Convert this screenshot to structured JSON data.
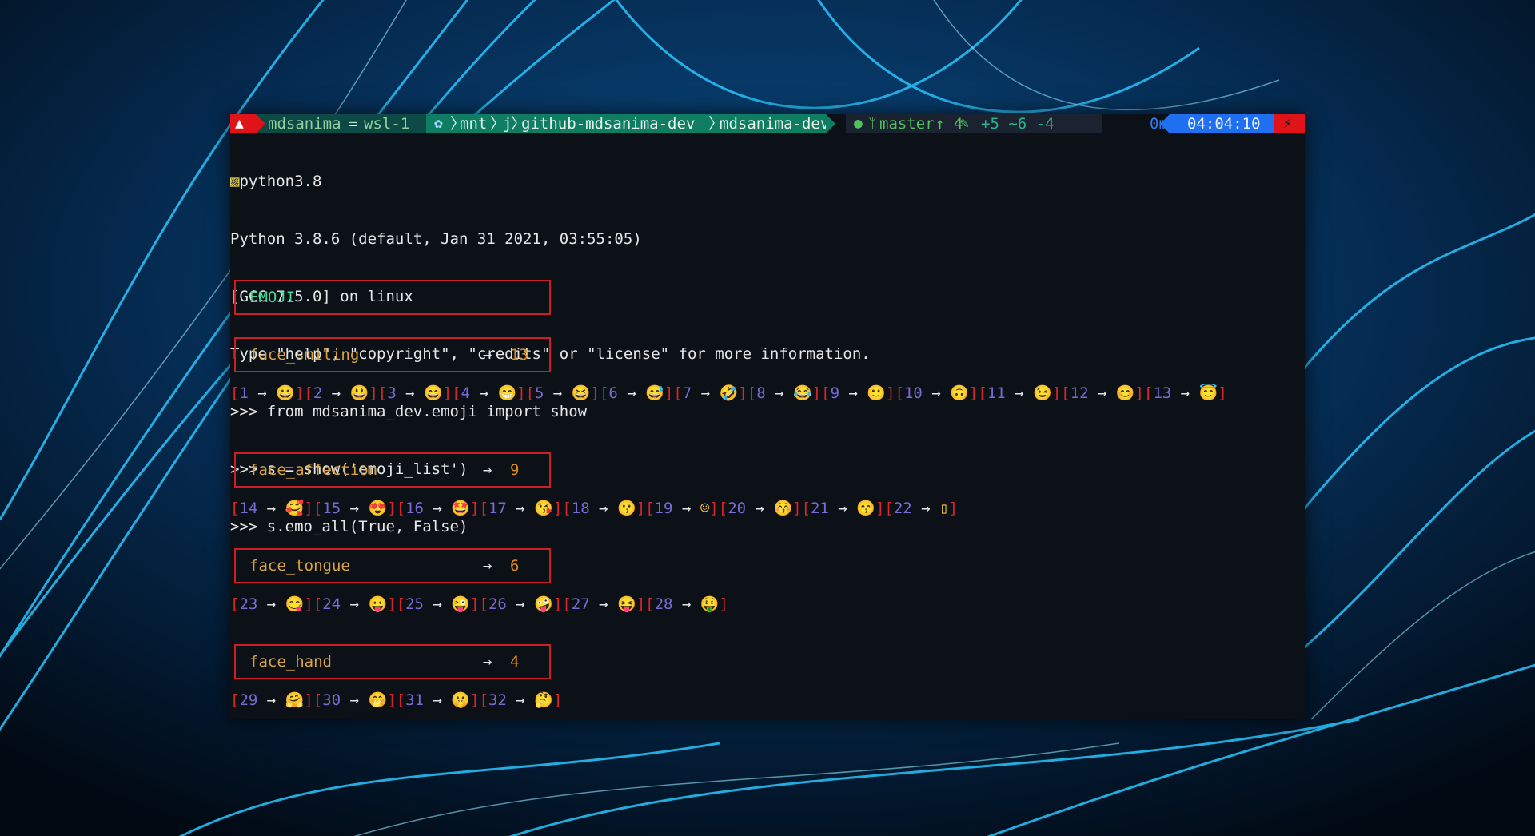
{
  "prompt": {
    "user": "mdsanima",
    "host": "wsl-1",
    "path": [
      "mnt",
      "j",
      "github-mdsanima-dev",
      "mdsanima-dev"
    ],
    "branch": "master",
    "ahead": "↑ 4",
    "changes": "+5 ~6 -4",
    "duration": "0ms",
    "clock": "04:04:10"
  },
  "console": {
    "lines": [
      "python3.8",
      "Python 3.8.6 (default, Jan 31 2021, 03:55:05)",
      "[GCC 7.5.0] on linux",
      "Type \"help\", \"copyright\", \"credits\" or \"license\" for more information.",
      ">>> from mdsanima_dev.emoji import show",
      ">>> s = show('emoji_list')",
      ">>> s.emo_all(True, False)"
    ]
  },
  "title_box": {
    "label": "EMOJI"
  },
  "arrow_glyph": "→",
  "groups": [
    {
      "label": "face_smiling",
      "count": "13",
      "items": [
        {
          "n": "1",
          "e": "😀"
        },
        {
          "n": "2",
          "e": "😃"
        },
        {
          "n": "3",
          "e": "😄"
        },
        {
          "n": "4",
          "e": "😁"
        },
        {
          "n": "5",
          "e": "😆"
        },
        {
          "n": "6",
          "e": "😅"
        },
        {
          "n": "7",
          "e": "🤣"
        },
        {
          "n": "8",
          "e": "😂"
        },
        {
          "n": "9",
          "e": "🙂"
        },
        {
          "n": "10",
          "e": "🙃"
        },
        {
          "n": "11",
          "e": "😉"
        },
        {
          "n": "12",
          "e": "😊"
        },
        {
          "n": "13",
          "e": "😇"
        }
      ]
    },
    {
      "label": "face_affection",
      "count": "9",
      "items": [
        {
          "n": "14",
          "e": "🥰"
        },
        {
          "n": "15",
          "e": "😍"
        },
        {
          "n": "16",
          "e": "🤩"
        },
        {
          "n": "17",
          "e": "😘"
        },
        {
          "n": "18",
          "e": "😗"
        },
        {
          "n": "19",
          "e": "☺"
        },
        {
          "n": "20",
          "e": "😚"
        },
        {
          "n": "21",
          "e": "😙"
        },
        {
          "n": "22",
          "e": "▯"
        }
      ]
    },
    {
      "label": "face_tongue",
      "count": "6",
      "items": [
        {
          "n": "23",
          "e": "😋"
        },
        {
          "n": "24",
          "e": "😛"
        },
        {
          "n": "25",
          "e": "😜"
        },
        {
          "n": "26",
          "e": "🤪"
        },
        {
          "n": "27",
          "e": "😝"
        },
        {
          "n": "28",
          "e": "🤑"
        }
      ]
    },
    {
      "label": "face_hand",
      "count": "4",
      "items": [
        {
          "n": "29",
          "e": "🤗"
        },
        {
          "n": "30",
          "e": "🤭"
        },
        {
          "n": "31",
          "e": "🤫"
        },
        {
          "n": "32",
          "e": "🤔"
        }
      ]
    }
  ],
  "colors": {
    "bracket": "#d8262a",
    "number": "#7a6ad6",
    "label": "#d7a440",
    "count": "#e08a1e",
    "title": "#48d597"
  }
}
